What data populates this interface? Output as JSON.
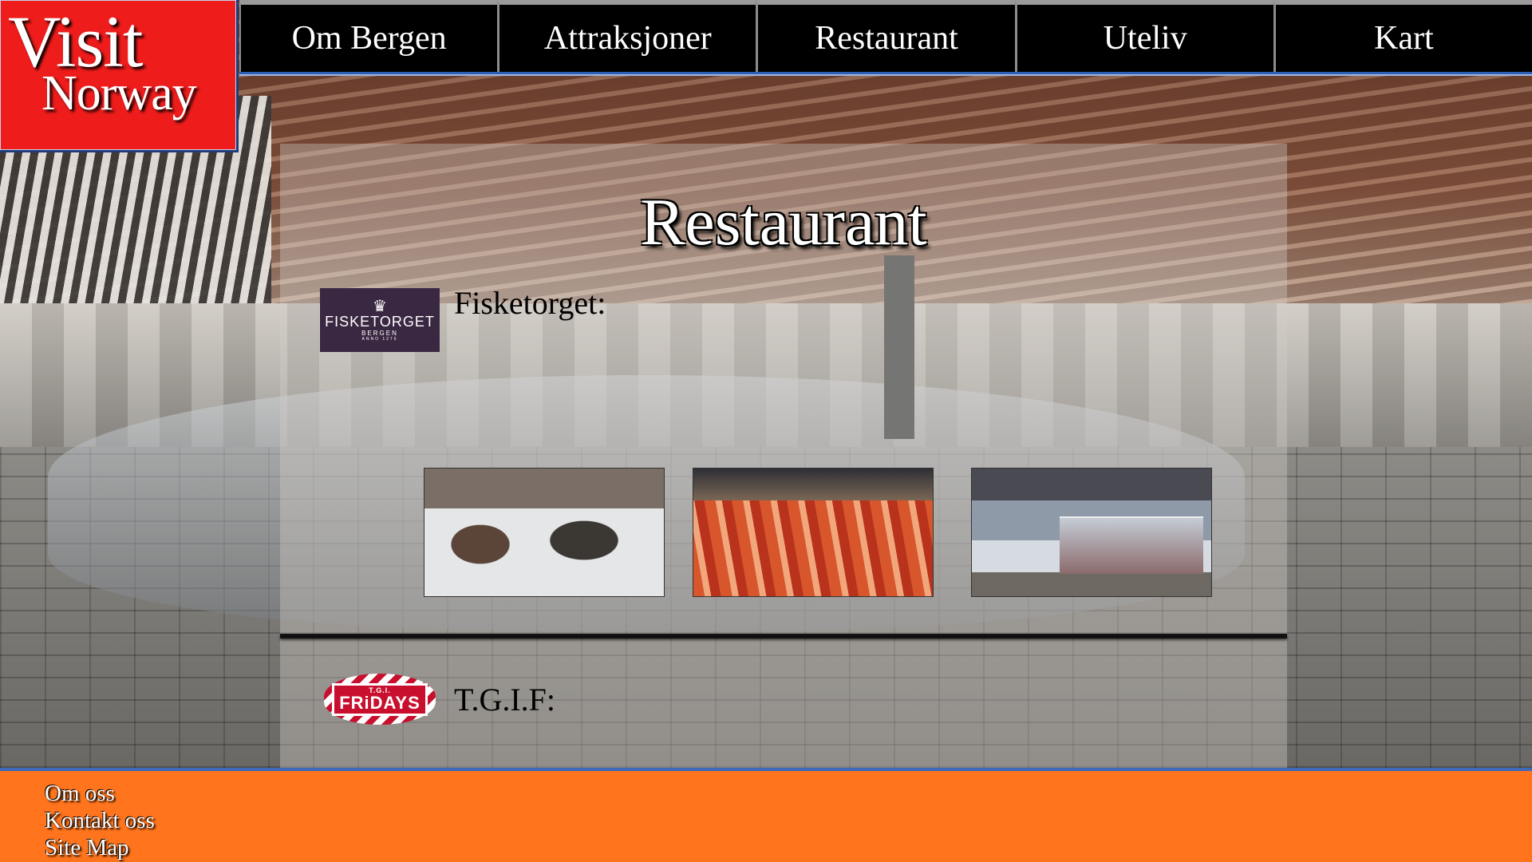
{
  "logo": {
    "line1": "Visit",
    "line2": "Norway",
    "color": "#ef1c1c"
  },
  "nav": {
    "items": [
      {
        "label": "Om Bergen"
      },
      {
        "label": "Attraksjoner"
      },
      {
        "label": "Restaurant"
      },
      {
        "label": "Uteliv"
      },
      {
        "label": "Kart"
      }
    ]
  },
  "main": {
    "title": "Restaurant",
    "restaurants": [
      {
        "name": "Fisketorget:",
        "logo": {
          "line1": "FISKETORGET",
          "line2": "BERGEN",
          "line3": "ANNO 1276",
          "icon": "fork-crown-icon"
        },
        "photos": [
          "monkfish-photo",
          "seafood-counter-photo",
          "market-interior-photo"
        ]
      },
      {
        "name": "T.G.I.F:",
        "logo": {
          "line1": "T.G.I.",
          "line2": "FRiDAYS"
        }
      }
    ]
  },
  "footer": {
    "links": [
      {
        "label": "Om oss"
      },
      {
        "label": "Kontakt oss"
      },
      {
        "label": "Site Map"
      }
    ],
    "color": "#ff741c"
  }
}
